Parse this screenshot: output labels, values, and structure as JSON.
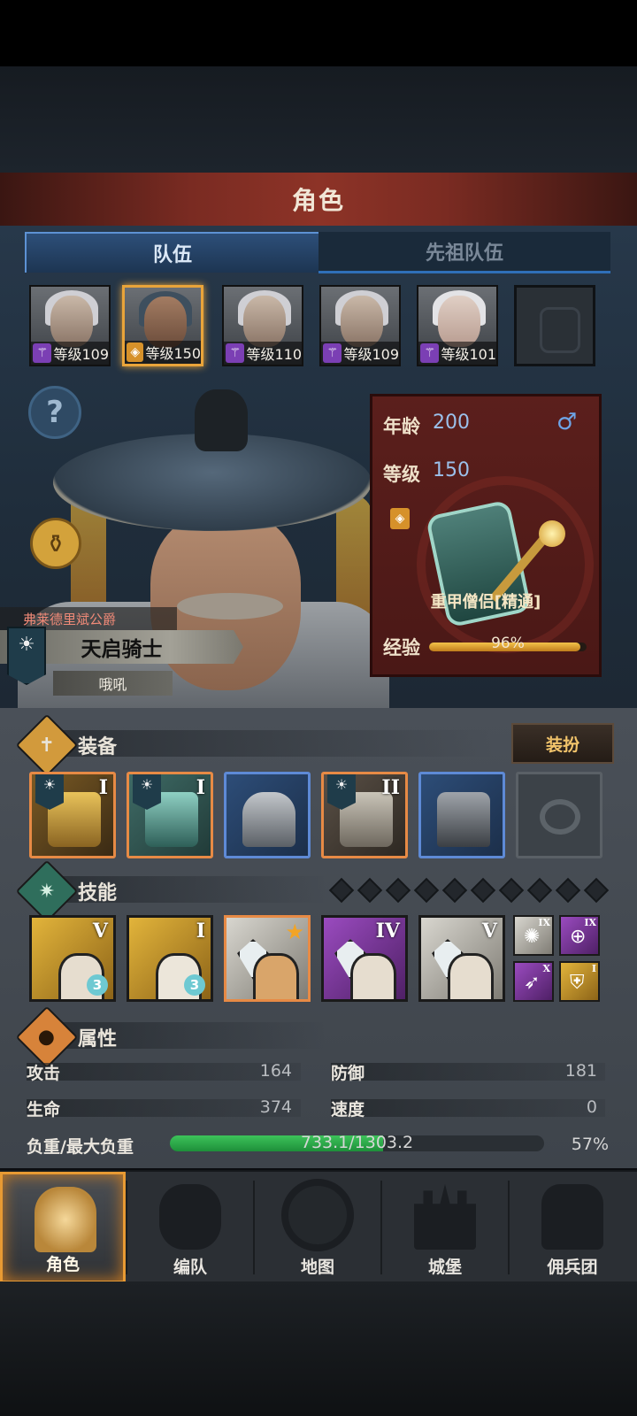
{
  "header": {
    "title": "角色"
  },
  "tabs": [
    {
      "label": "队伍",
      "active": true
    },
    {
      "label": "先祖队伍",
      "active": false
    }
  ],
  "party": [
    {
      "level": "等级109",
      "class_icon": "staff-icon",
      "selected": false
    },
    {
      "level": "等级150",
      "class_icon": "shield-icon",
      "selected": true
    },
    {
      "level": "等级110",
      "class_icon": "staff-icon",
      "selected": false
    },
    {
      "level": "等级109",
      "class_icon": "staff-icon",
      "selected": false
    },
    {
      "level": "等级101",
      "class_icon": "staff-icon",
      "selected": false
    },
    {
      "level": "",
      "class_icon": "empty-slot-icon",
      "selected": false
    }
  ],
  "character": {
    "title_small": "弗莱德里斌公爵",
    "name": "天启骑士",
    "subtitle": "哦吼",
    "age_label": "年龄",
    "age": "200",
    "gender_symbol": "♂",
    "level_label": "等级",
    "level": "150",
    "class_name": "重甲僧侣[精通]",
    "exp_label": "经验",
    "exp_text": "96%",
    "exp_fraction": 0.96
  },
  "equipment": {
    "title": "装备",
    "dress_button": "装扮",
    "slots": [
      {
        "name": "weapon",
        "rank": "I",
        "rarity": "orange",
        "has_banner": true,
        "icon": "mace-icon"
      },
      {
        "name": "shield",
        "rank": "I",
        "rarity": "orange",
        "has_banner": true,
        "icon": "shield-icon"
      },
      {
        "name": "helmet",
        "rank": "",
        "rarity": "blue",
        "has_banner": false,
        "icon": "helmet-icon"
      },
      {
        "name": "armor",
        "rank": "II",
        "rarity": "orange",
        "has_banner": true,
        "icon": "armor-icon"
      },
      {
        "name": "boots",
        "rank": "",
        "rarity": "blue",
        "has_banner": false,
        "icon": "boots-icon"
      },
      {
        "name": "ring",
        "rank": "",
        "rarity": "empty",
        "has_banner": false,
        "icon": "ring-icon"
      }
    ]
  },
  "skills": {
    "title": "技能",
    "diamond_count": 10,
    "list": [
      {
        "rank": "V",
        "color": "gold",
        "badge": "3",
        "icon": "target-hand-icon"
      },
      {
        "rank": "I",
        "color": "gold",
        "badge": "3",
        "icon": "heal-shield-icon"
      },
      {
        "rank": "★",
        "color": "white",
        "badge": "",
        "icon": "gem-hand-icon"
      },
      {
        "rank": "IV",
        "color": "purple",
        "badge": "",
        "icon": "gem-hand-icon"
      },
      {
        "rank": "V",
        "color": "white",
        "badge": "",
        "icon": "gem-hand-icon"
      }
    ],
    "mini": [
      {
        "rank": "IX",
        "color": "white",
        "icon": "burst-icon"
      },
      {
        "rank": "IX",
        "color": "purple",
        "icon": "target-icon"
      },
      {
        "rank": "X",
        "color": "purple",
        "icon": "spear-icon"
      },
      {
        "rank": "I",
        "color": "gold",
        "icon": "shield-icon"
      }
    ]
  },
  "attributes": {
    "title": "属性",
    "attack_label": "攻击",
    "attack": "164",
    "defense_label": "防御",
    "defense": "181",
    "hp_label": "生命",
    "hp": "374",
    "speed_label": "速度",
    "speed": "0",
    "load_label": "负重/最大负重",
    "load_text": "733.1/1303.2",
    "load_pct": "57%",
    "load_fraction": 0.57
  },
  "nav": [
    {
      "label": "角色",
      "icon": "knight-icon",
      "active": true
    },
    {
      "label": "编队",
      "icon": "formation-icon",
      "active": false
    },
    {
      "label": "地图",
      "icon": "compass-map-icon",
      "active": false
    },
    {
      "label": "城堡",
      "icon": "castle-icon",
      "active": false
    },
    {
      "label": "佣兵团",
      "icon": "mercenary-icon",
      "active": false
    }
  ],
  "colors": {
    "rarity_orange": "#e78a45",
    "rarity_blue": "#5e8ad6",
    "accent_gold": "#e9a43a",
    "load_green": "#2db54e"
  }
}
